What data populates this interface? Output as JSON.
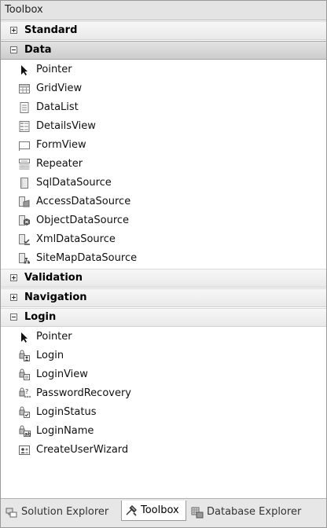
{
  "window": {
    "title": "Toolbox"
  },
  "groups": {
    "standard": {
      "label": "Standard"
    },
    "data": {
      "label": "Data",
      "items": [
        {
          "label": "Pointer",
          "icon": "pointer-icon"
        },
        {
          "label": "GridView",
          "icon": "gridview-icon"
        },
        {
          "label": "DataList",
          "icon": "datalist-icon"
        },
        {
          "label": "DetailsView",
          "icon": "detailsview-icon"
        },
        {
          "label": "FormView",
          "icon": "formview-icon"
        },
        {
          "label": "Repeater",
          "icon": "repeater-icon"
        },
        {
          "label": "SqlDataSource",
          "icon": "sqldatasource-icon"
        },
        {
          "label": "AccessDataSource",
          "icon": "accessdatasource-icon"
        },
        {
          "label": "ObjectDataSource",
          "icon": "objectdatasource-icon"
        },
        {
          "label": "XmlDataSource",
          "icon": "xmldatasource-icon"
        },
        {
          "label": "SiteMapDataSource",
          "icon": "sitemapdatasource-icon"
        }
      ]
    },
    "validation": {
      "label": "Validation"
    },
    "navigation": {
      "label": "Navigation"
    },
    "login": {
      "label": "Login",
      "items": [
        {
          "label": "Pointer",
          "icon": "pointer-icon"
        },
        {
          "label": "Login",
          "icon": "login-icon"
        },
        {
          "label": "LoginView",
          "icon": "loginview-icon"
        },
        {
          "label": "PasswordRecovery",
          "icon": "passwordrecovery-icon"
        },
        {
          "label": "LoginStatus",
          "icon": "loginstatus-icon"
        },
        {
          "label": "LoginName",
          "icon": "loginname-icon"
        },
        {
          "label": "CreateUserWizard",
          "icon": "createuserwizard-icon"
        }
      ]
    }
  },
  "tabs": [
    {
      "label": "Solution Explorer",
      "icon": "solution-explorer-icon",
      "active": false
    },
    {
      "label": "Toolbox",
      "icon": "toolbox-icon",
      "active": true
    },
    {
      "label": "Database Explorer",
      "icon": "database-explorer-icon",
      "active": false
    }
  ]
}
